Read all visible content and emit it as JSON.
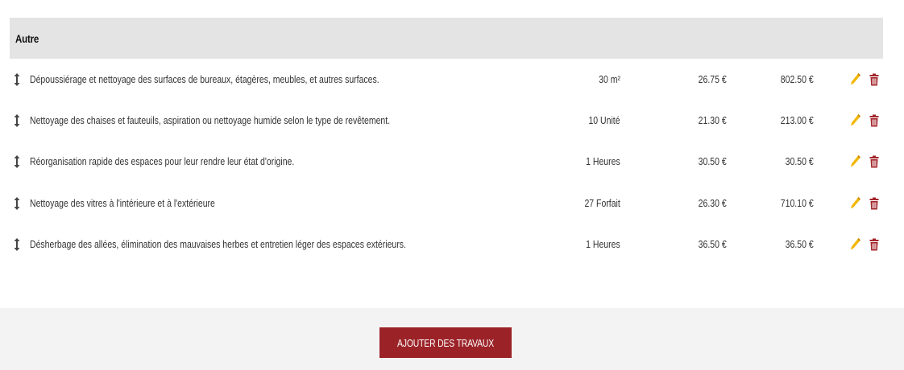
{
  "section": {
    "title": "Autre"
  },
  "rows": [
    {
      "description": "Dépoussiérage et nettoyage des surfaces de bureaux, étagères, meubles, et autres surfaces.",
      "quantity": "30 m²",
      "unit_price": "26.75 €",
      "total": "802.50 €"
    },
    {
      "description": "Nettoyage des chaises et fauteuils, aspiration ou nettoyage humide selon le type de revêtement.",
      "quantity": "10 Unité",
      "unit_price": "21.30 €",
      "total": "213.00 €"
    },
    {
      "description": "Réorganisation rapide des espaces pour leur rendre leur état d'origine.",
      "quantity": "1 Heures",
      "unit_price": "30.50 €",
      "total": "30.50 €"
    },
    {
      "description": "Nettoyage des vitres à l'intérieure et à l'extérieure",
      "quantity": "27 Forfait",
      "unit_price": "26.30 €",
      "total": "710.10 €"
    },
    {
      "description": "Désherbage des allées, élimination des mauvaises herbes et entretien léger des espaces extérieurs.",
      "quantity": "1 Heures",
      "unit_price": "36.50 €",
      "total": "36.50 €"
    }
  ],
  "icons": {
    "drag": "vertical-arrows-icon",
    "edit": "pencil-icon",
    "delete": "trash-icon"
  },
  "colors": {
    "header_bg": "#e4e4e4",
    "edit_icon": "#f2b705",
    "delete_icon": "#a3242a",
    "button_bg": "#9b2328",
    "footer_bg": "#f3f3f3"
  },
  "footer": {
    "add_button_label": "AJOUTER DES TRAVAUX"
  }
}
